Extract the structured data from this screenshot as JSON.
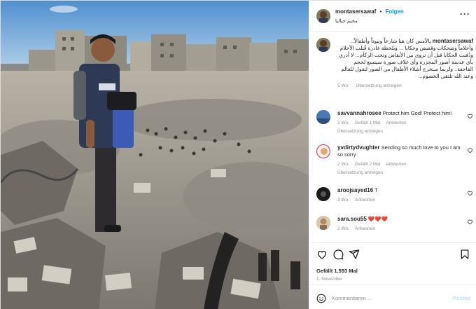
{
  "header": {
    "username": "montasersawaf",
    "separator": "•",
    "follow_label": "Folgen",
    "location": "مخيم جباليا",
    "more_label": "···"
  },
  "caption": {
    "username": "montasersawaf",
    "text": "بالأمس كان هنا شارعاً وبيوتاً وأطفالاً.. وأحلاماً وضحكات وقصص وحكايا ... وبلحظة غادرة قُتلت الأحلام ودُفنت الحكايا قبل أن تروى بين الأنقاض وتحت الركام... لا أدري بأي عدسة أصور المجزرة وأي غلاف صورة سيتسع لحجم الفاجعة.. ولربما سنخرج أشلاء الأطفال من الصور لتقول للعالم وعند الله تلتقي الخصوم...",
    "time": "5 Wo.",
    "translate": "Übersetzung anzeigen"
  },
  "comments": [
    {
      "username": "savvannahrosee",
      "text": "Protect him God! Protect him!",
      "time": "2 Wo.",
      "likes": "Gefällt 1 Mal",
      "reply": "Antworten",
      "translate": "Übersetzung anzeigen"
    },
    {
      "username": "yvdirtydvughter",
      "text": "Sending so much love to you I am so sorry",
      "time": "2 Wo.",
      "likes": "Gefällt 2 Mal",
      "reply": "Antworten",
      "translate": "Übersetzung anzeigen"
    },
    {
      "username": "aroojsayed16",
      "text": "T",
      "time": "3 Wo.",
      "reply": "Antworten"
    },
    {
      "username": "sara.sou55",
      "text": "❤️❤️❤️",
      "time": "2 Wo.",
      "reply": "Antworten"
    }
  ],
  "actions": {
    "likes": "Gefällt 1.593 Mal",
    "date": "1. November",
    "icons": [
      "heart-icon",
      "comment-icon",
      "share-icon",
      "bookmark-icon"
    ]
  },
  "composer": {
    "placeholder": "Kommentieren ...",
    "post_label": "Posten"
  },
  "colors": {
    "accent": "#0095f6",
    "post_disabled": "#b2dffc",
    "muted": "#8e8e8e",
    "heart_red": "#ed4956"
  }
}
